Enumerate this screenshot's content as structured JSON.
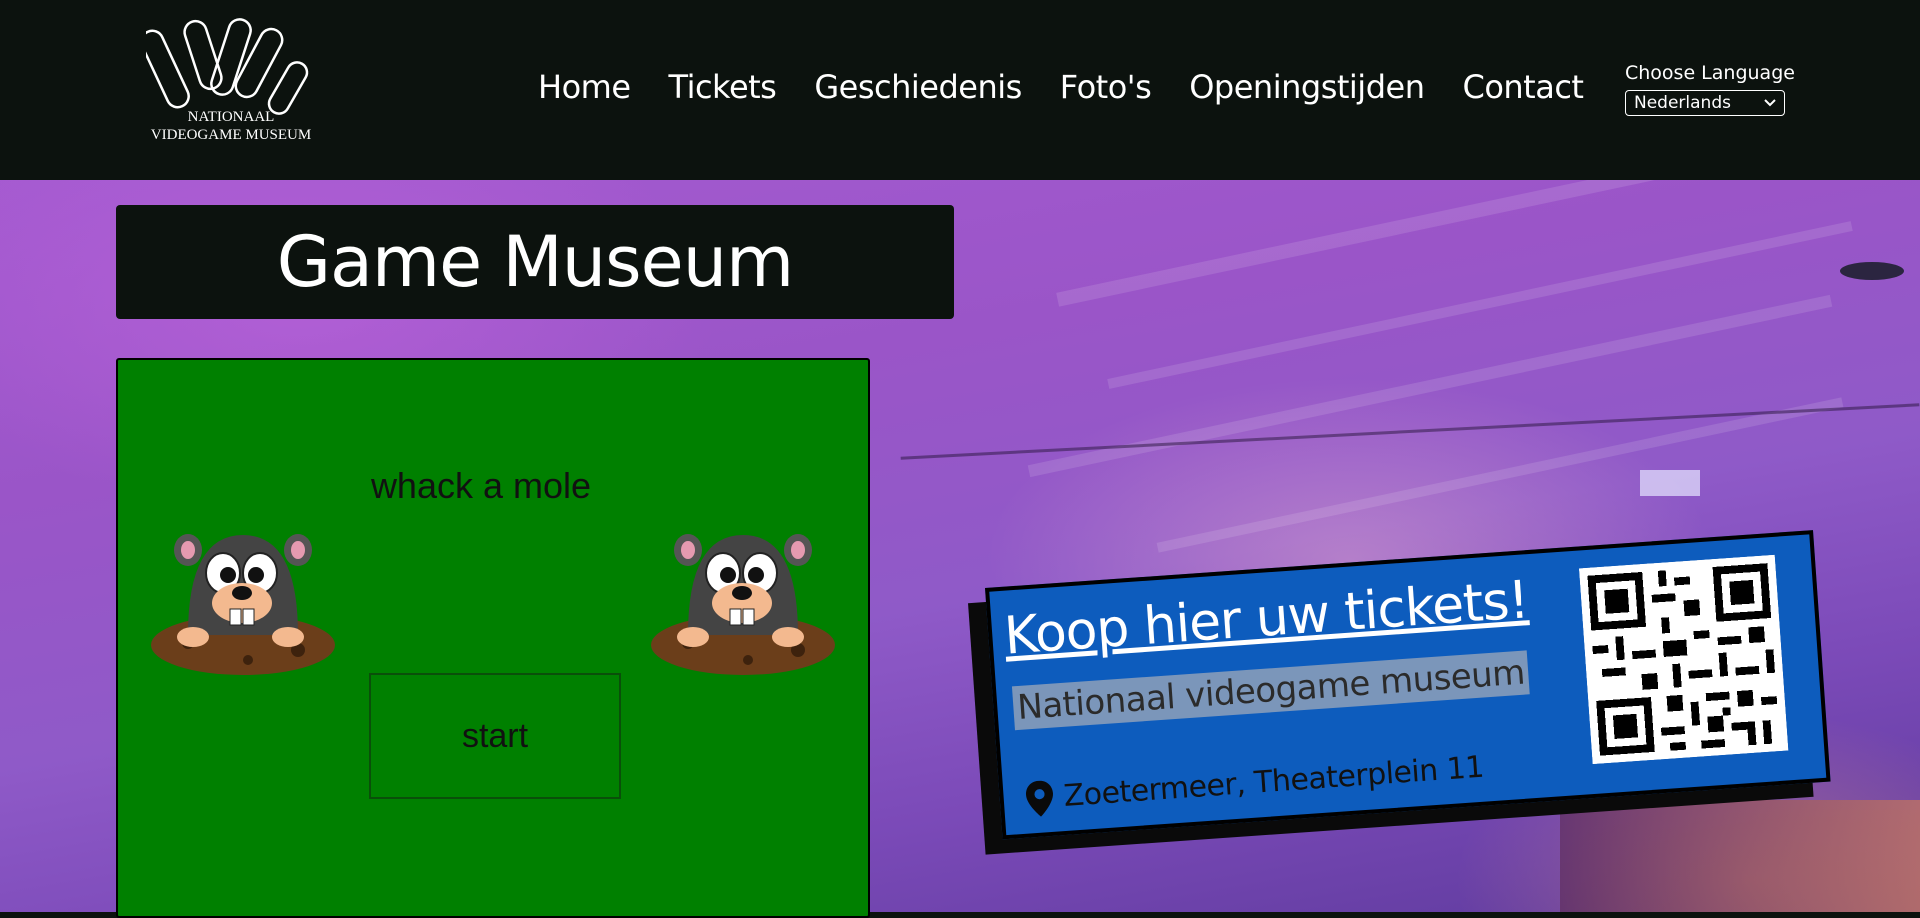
{
  "header": {
    "logo": {
      "line1": "NATIONAAL",
      "line2": "VIDEOGAME MUSEUM"
    },
    "nav": [
      "Home",
      "Tickets",
      "Geschiedenis",
      "Foto's",
      "Openingstijden",
      "Contact"
    ],
    "language": {
      "label": "Choose Language",
      "selected": "Nederlands"
    }
  },
  "hero": {
    "title": "Game Museum"
  },
  "game": {
    "title": "whack a mole",
    "start_label": "start"
  },
  "ticket": {
    "link": "Koop hier uw tickets!",
    "subtitle": "Nationaal videogame museum",
    "address": "Zoetermeer, Theaterplein 11"
  },
  "colors": {
    "header_bg": "#0c120e",
    "game_green": "#008000",
    "ticket_blue": "#0d5cbd"
  }
}
